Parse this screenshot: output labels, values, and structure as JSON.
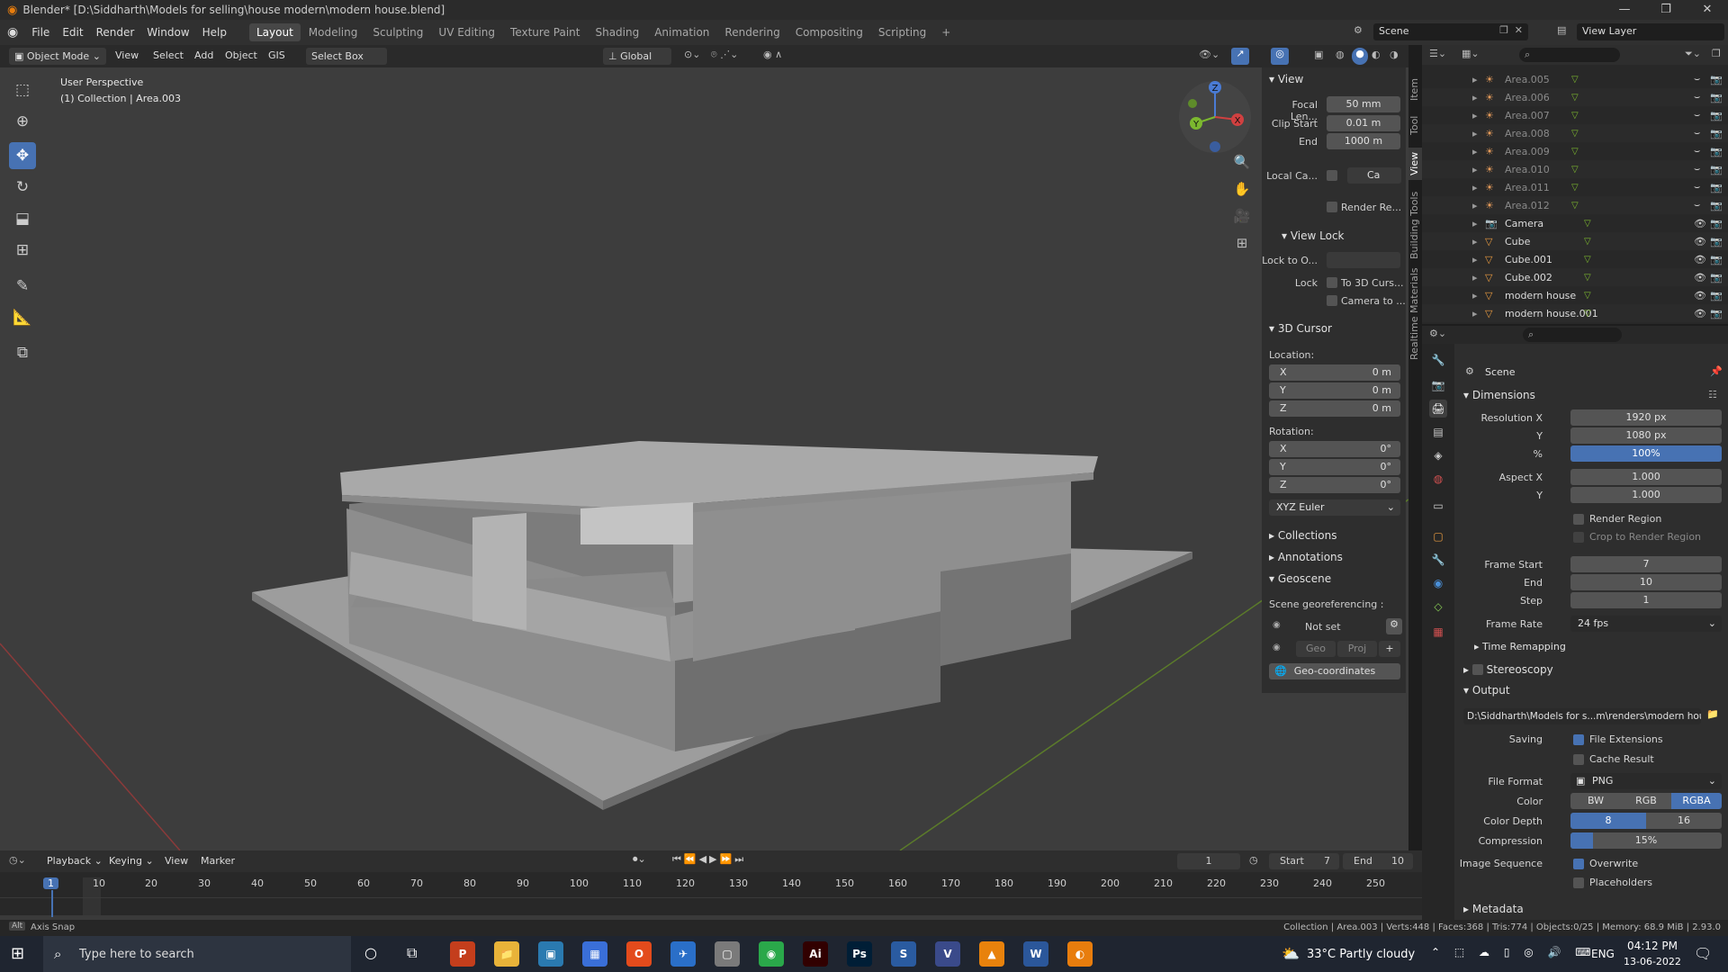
{
  "title_bar": {
    "title": "Blender* [D:\\Siddharth\\Models for selling\\house modern\\modern house.blend]",
    "minimize": "—",
    "maximize": "❐",
    "close": "✕"
  },
  "menu": {
    "items": [
      "File",
      "Edit",
      "Render",
      "Window",
      "Help"
    ],
    "workspaces": [
      "Layout",
      "Modeling",
      "Sculpting",
      "UV Editing",
      "Texture Paint",
      "Shading",
      "Animation",
      "Rendering",
      "Compositing",
      "Scripting"
    ],
    "active_workspace": "Layout",
    "add_tab": "+",
    "scene": "Scene",
    "view_layer": "View Layer"
  },
  "viewport_header": {
    "mode": "Object Mode",
    "view": "View",
    "select": "Select",
    "add": "Add",
    "object": "Object",
    "gis": "GIS",
    "select_box": "Select Box",
    "orientation": "Global"
  },
  "viewport": {
    "perspective": "User Perspective",
    "collection": "(1) Collection | Area.003",
    "gizmo": {
      "x": "X",
      "y": "Y",
      "z": "Z"
    }
  },
  "npanel": {
    "view_head": "View",
    "focal_label": "Focal Len...",
    "focal_value": "50 mm",
    "clip_start_label": "Clip Start",
    "clip_start_value": "0.01 m",
    "end_label": "End",
    "end_value": "1000 m",
    "local_camera_label": "Local Ca...",
    "local_camera_value": "Ca",
    "render_region": "Render Re...",
    "view_lock_head": "View Lock",
    "lock_to_object_label": "Lock to O...",
    "lock_label": "Lock",
    "lock_3d_cursor": "To 3D Curs...",
    "camera_to": "Camera to ...",
    "cursor_head": "3D Cursor",
    "location_label": "Location:",
    "loc": [
      {
        "axis": "X",
        "value": "0 m"
      },
      {
        "axis": "Y",
        "value": "0 m"
      },
      {
        "axis": "Z",
        "value": "0 m"
      }
    ],
    "rotation_label": "Rotation:",
    "rot": [
      {
        "axis": "X",
        "value": "0°"
      },
      {
        "axis": "Y",
        "value": "0°"
      },
      {
        "axis": "Z",
        "value": "0°"
      }
    ],
    "rotation_mode": "XYZ Euler",
    "collections_head": "Collections",
    "annotations_head": "Annotations",
    "geoscene_head": "Geoscene",
    "georef_label": "Scene georeferencing :",
    "not_set": "Not set",
    "geo": "Geo",
    "proj": "Proj",
    "geo_coordinates": "Geo-coordinates",
    "tabs": [
      "Item",
      "Tool",
      "View",
      "Building Tools",
      "Realtime Materials"
    ]
  },
  "outliner": {
    "items": [
      {
        "name": "Area.005",
        "type": "light"
      },
      {
        "name": "Area.006",
        "type": "light"
      },
      {
        "name": "Area.007",
        "type": "light"
      },
      {
        "name": "Area.008",
        "type": "light"
      },
      {
        "name": "Area.009",
        "type": "light"
      },
      {
        "name": "Area.010",
        "type": "light"
      },
      {
        "name": "Area.011",
        "type": "light"
      },
      {
        "name": "Area.012",
        "type": "light"
      },
      {
        "name": "Camera",
        "type": "camera"
      },
      {
        "name": "Cube",
        "type": "mesh"
      },
      {
        "name": "Cube.001",
        "type": "mesh"
      },
      {
        "name": "Cube.002",
        "type": "mesh"
      },
      {
        "name": "modern house",
        "type": "mesh"
      },
      {
        "name": "modern house.001",
        "type": "mesh"
      }
    ]
  },
  "properties": {
    "context": "Scene",
    "dimensions_head": "Dimensions",
    "res_x_label": "Resolution X",
    "res_x": "1920 px",
    "res_y_label": "Y",
    "res_y": "1080 px",
    "res_pct_label": "%",
    "res_pct": "100%",
    "aspect_x_label": "Aspect X",
    "aspect_x": "1.000",
    "aspect_y_label": "Y",
    "aspect_y": "1.000",
    "render_region": "Render Region",
    "crop_region": "Crop to Render Region",
    "frame_start_label": "Frame Start",
    "frame_start": "7",
    "end_label": "End",
    "end": "10",
    "step_label": "Step",
    "step": "1",
    "frame_rate_label": "Frame Rate",
    "frame_rate": "24 fps",
    "time_remapping": "Time Remapping",
    "stereoscopy": "Stereoscopy",
    "output_head": "Output",
    "output_path": "D:\\Siddharth\\Models for s...m\\renders\\modern house",
    "saving_label": "Saving",
    "file_extensions": "File Extensions",
    "cache_result": "Cache Result",
    "file_format_label": "File Format",
    "file_format": "PNG",
    "color_label": "Color",
    "color_opts": [
      "BW",
      "RGB",
      "RGBA"
    ],
    "color_depth_label": "Color Depth",
    "depth_opts": [
      "8",
      "16"
    ],
    "compression_label": "Compression",
    "compression": "15%",
    "image_sequence_label": "Image Sequence",
    "overwrite": "Overwrite",
    "placeholders": "Placeholders",
    "metadata": "Metadata"
  },
  "timeline": {
    "playback": "Playback",
    "keying": "Keying",
    "view": "View",
    "marker": "Marker",
    "current_frame": "1",
    "start_label": "Start",
    "start": "7",
    "end_label": "End",
    "end": "10",
    "ticks": [
      "1",
      "10",
      "20",
      "30",
      "40",
      "50",
      "60",
      "70",
      "80",
      "90",
      "100",
      "110",
      "120",
      "130",
      "140",
      "150",
      "160",
      "170",
      "180",
      "190",
      "200",
      "210",
      "220",
      "230",
      "240",
      "250"
    ]
  },
  "status": {
    "left": "Axis Snap",
    "right": "Collection | Area.003 | Verts:448 | Faces:368 | Tris:774 | Objects:0/25 | Memory: 68.9 MiB | 2.93.0"
  },
  "taskbar": {
    "search_placeholder": "Type here to search",
    "weather": "33°C  Partly cloudy",
    "lang": "ENG",
    "time": "04:12 PM",
    "date": "13-06-2022",
    "apps": [
      "P",
      "📁",
      "▣",
      "▦",
      "O",
      "✈",
      "▢",
      "◉",
      "Ai",
      "Ps",
      "S",
      "V",
      "▲",
      "W",
      "◐"
    ]
  }
}
